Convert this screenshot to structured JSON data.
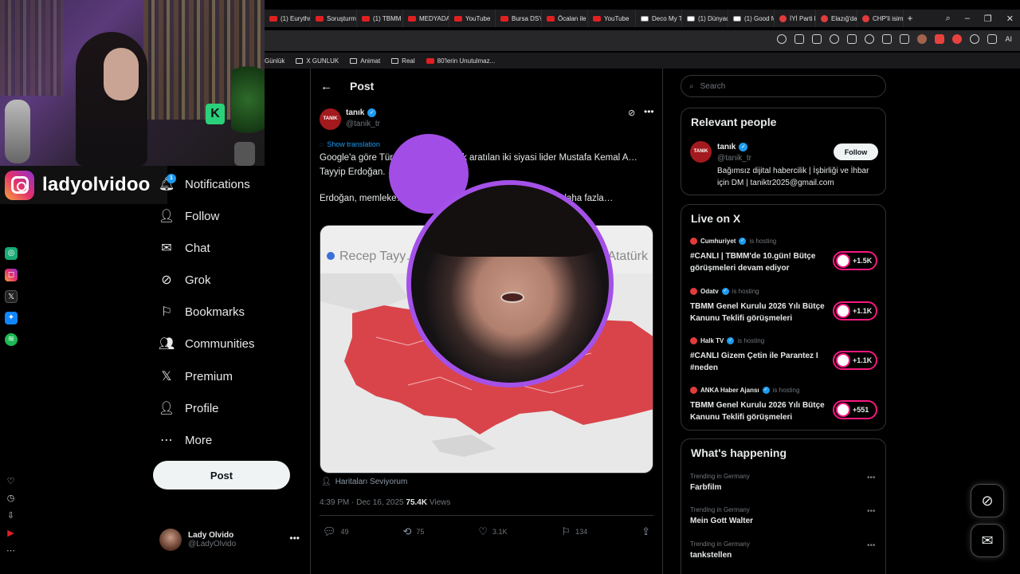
{
  "browser": {
    "tabs": [
      {
        "label": "(1) Eurythm",
        "icon": "youtube-icon"
      },
      {
        "label": "Soruşturma",
        "icon": "youtube-icon"
      },
      {
        "label": "(1) TBMM",
        "icon": "youtube-icon"
      },
      {
        "label": "MEDYADA",
        "icon": "youtube-icon"
      },
      {
        "label": "YouTube",
        "icon": "youtube-icon"
      },
      {
        "label": "Bursa DSYİ",
        "icon": "youtube-icon"
      },
      {
        "label": "Öcalan ile",
        "icon": "youtube-icon"
      },
      {
        "label": "YouTube",
        "icon": "youtube-icon"
      },
      {
        "label": "Deco My T",
        "icon": "record-icon"
      },
      {
        "label": "(1) Dünyad",
        "icon": "record-icon"
      },
      {
        "label": "(1) Good M",
        "icon": "record-icon"
      },
      {
        "label": "İYİ Parti ka",
        "icon": "cumhuriyet-icon"
      },
      {
        "label": "Elazığ'da",
        "icon": "cumhuriyet-icon"
      },
      {
        "label": "CHP'li isim",
        "icon": "cumhuriyet-icon"
      }
    ],
    "new_tab": "+",
    "ai_label": "AI",
    "bookmarks": [
      {
        "label": "Günlük",
        "icon": "none"
      },
      {
        "label": "X GUNLUK",
        "icon": "folder-icon"
      },
      {
        "label": "Animat",
        "icon": "folder-icon"
      },
      {
        "label": "Real",
        "icon": "folder-icon"
      },
      {
        "label": "80'lerin Unutulmaz...",
        "icon": "youtube-icon"
      }
    ]
  },
  "stream": {
    "brand_name": "ladyolvidoo",
    "brand_icon": "instagram-icon",
    "webcam_sign": "K"
  },
  "nav": {
    "notification_badge": "1",
    "items": [
      {
        "label": "Notifications",
        "icon": "bell-icon"
      },
      {
        "label": "Follow",
        "icon": "add-user-icon"
      },
      {
        "label": "Chat",
        "icon": "envelope-icon"
      },
      {
        "label": "Grok",
        "icon": "grok-icon"
      },
      {
        "label": "Bookmarks",
        "icon": "bookmark-icon"
      },
      {
        "label": "Communities",
        "icon": "people-icon"
      },
      {
        "label": "Premium",
        "icon": "x-logo-icon"
      },
      {
        "label": "Profile",
        "icon": "person-icon"
      },
      {
        "label": "More",
        "icon": "more-circle-icon"
      }
    ],
    "post_button": "Post",
    "account": {
      "name": "Lady Olvido",
      "handle": "@LadyOlvido"
    }
  },
  "post": {
    "header_title": "Post",
    "author": {
      "name": "tanık",
      "handle": "@tanik_tr",
      "avatar_text": "TANIK"
    },
    "show_translation": "Show translation",
    "paragraph1": "Google'a göre Tür… bu yana en çok aratılan iki siyasi lider Mustafa Kemal A… Tayyip Erdoğan.",
    "paragraph2": "Erdoğan, memleke… …alan 80 ilde Mustafa Kemal Atatürk daha fazla…",
    "map": {
      "title": "Google'a g… …der",
      "legend_left": "Recep Tayy…",
      "legend_right": "Atatürk"
    },
    "source": "Haritaları Seviyorum",
    "time": "4:39 PM · Dec 16, 2025",
    "views_value": "75.4K",
    "views_label": "Views",
    "actions": {
      "replies": "49",
      "reposts": "75",
      "likes": "3.1K",
      "bookmarks": "134"
    }
  },
  "right": {
    "search_placeholder": "Search",
    "relevant_people": {
      "title": "Relevant people",
      "name": "tanık",
      "handle": "@tanik_tr",
      "follow": "Follow",
      "bio": "Bağımsız dijital habercilik | İşbirliği ve İhbar için DM | taniktr2025@gmail.com"
    },
    "live": {
      "title": "Live on X",
      "hosting_label": "is hosting",
      "items": [
        {
          "host": "Cumhuriyet",
          "title": "#CANLI | TBMM'de 10.gün! Bütçe görüşmeleri devam ediyor",
          "count": "+1.5K"
        },
        {
          "host": "Odatv",
          "title": "TBMM Genel Kurulu 2026 Yılı Bütçe Kanunu Teklifi görüşmeleri",
          "count": "+1.1K"
        },
        {
          "host": "Halk TV",
          "title": "#CANLI Gizem Çetin ile Parantez I #neden",
          "count": "+1.1K"
        },
        {
          "host": "ANKA Haber Ajansı",
          "title": "TBMM Genel Kurulu 2026 Yılı Bütçe Kanunu Teklifi görüşmeleri",
          "count": "+551"
        }
      ]
    },
    "happening": {
      "title": "What's happening",
      "trends": [
        {
          "context": "Trending in Germany",
          "name": "Farbfilm"
        },
        {
          "context": "Trending in Germany",
          "name": "Mein Gott Walter"
        },
        {
          "context": "Trending in Germany",
          "name": "tankstellen"
        }
      ]
    }
  },
  "colors": {
    "accent": "#1d9bf0",
    "live_pink": "#f91880",
    "facecam_border": "#a451e8",
    "map_red": "#d9444a"
  }
}
